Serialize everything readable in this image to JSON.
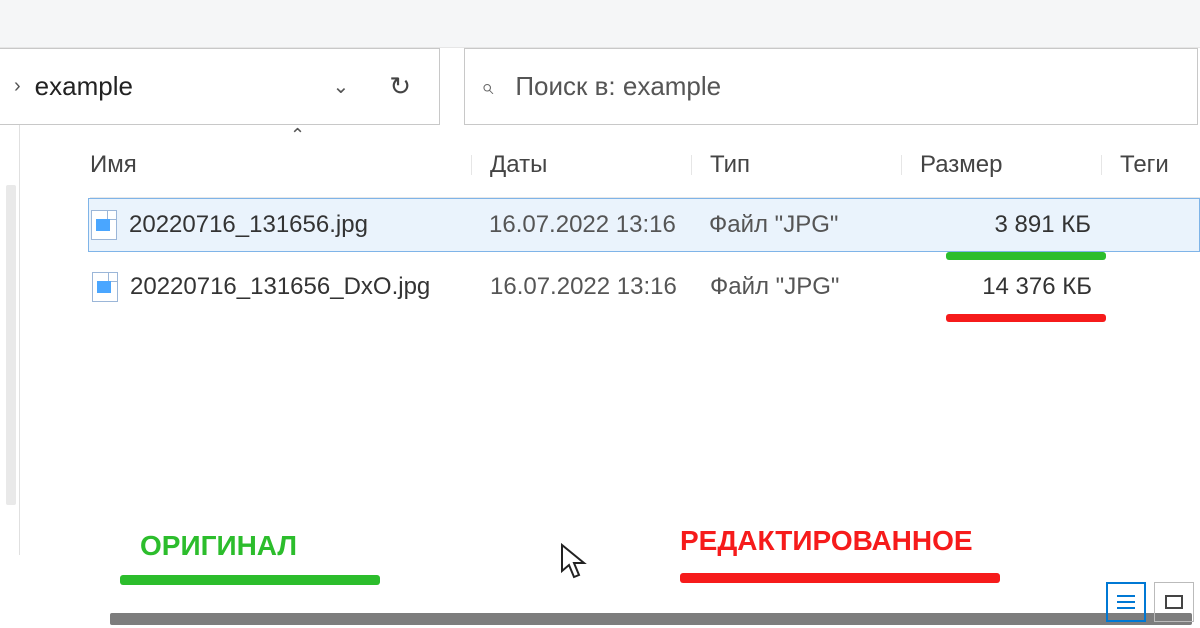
{
  "toolbar": {
    "breadcrumb_current": "example",
    "search_placeholder": "Поиск в: example"
  },
  "columns": {
    "name": "Имя",
    "dates": "Даты",
    "type": "Тип",
    "size": "Размер",
    "tags": "Теги"
  },
  "files": [
    {
      "name": "20220716_131656.jpg",
      "date": "16.07.2022 13:16",
      "type": "Файл \"JPG\"",
      "size": "3 891 КБ",
      "selected": true,
      "underline_color": "green"
    },
    {
      "name": "20220716_131656_DxO.jpg",
      "date": "16.07.2022 13:16",
      "type": "Файл \"JPG\"",
      "size": "14 376 КБ",
      "selected": false,
      "underline_color": "red"
    }
  ],
  "annotations": {
    "original_label": "ОРИГИНАЛ",
    "edited_label": "РЕДАКТИРОВАННОЕ",
    "colors": {
      "green": "#2cbd2c",
      "red": "#f61b1b"
    }
  }
}
